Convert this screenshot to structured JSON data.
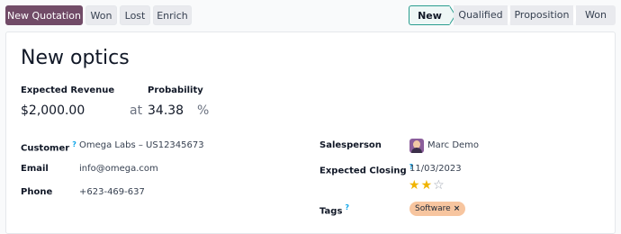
{
  "toolbar": {
    "new_quotation": "New Quotation",
    "won": "Won",
    "lost": "Lost",
    "enrich": "Enrich"
  },
  "pipeline": {
    "stages": [
      "New",
      "Qualified",
      "Proposition",
      "Won"
    ],
    "active": "New"
  },
  "record": {
    "title": "New optics",
    "expected_revenue_label": "Expected Revenue",
    "expected_revenue": "$2,000.00",
    "at": "at",
    "probability_label": "Probability",
    "probability": "34.38",
    "percent": "%",
    "customer_label": "Customer",
    "customer_help": "?",
    "customer": "Omega Labs – US12345673",
    "email_label": "Email",
    "email": "info@omega.com",
    "phone_label": "Phone",
    "phone": "+623-469-637",
    "salesperson_label": "Salesperson",
    "salesperson": "Marc Demo",
    "expected_closing_label": "Expected Closing",
    "expected_closing_help": "?",
    "expected_closing": "11/03/2023",
    "priority": 2,
    "priority_max": 3,
    "tags_label": "Tags",
    "tags_help": "?",
    "tags": [
      "Software"
    ]
  },
  "colors": {
    "brand": "#714b67",
    "active_stage_border": "#2a9d8f",
    "star": "#f0b400",
    "tag_bg": "#f7c59f"
  }
}
